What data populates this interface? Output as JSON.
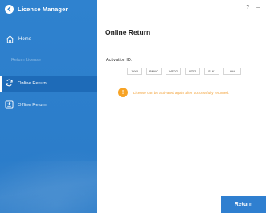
{
  "app": {
    "title": "License Manager",
    "logo_icon": "back-arrow-circle-icon"
  },
  "window_controls": {
    "help": "?",
    "minimize": "–"
  },
  "sidebar": {
    "home_label": "Home",
    "section_label": "Return License",
    "items": [
      {
        "label": "Online Return",
        "icon": "online-return-icon",
        "active": true
      },
      {
        "label": "Offline Return",
        "icon": "offline-return-icon",
        "active": false
      }
    ]
  },
  "main": {
    "title": "Online Return",
    "activation_label": "Activation ID:",
    "activation_keys": [
      "JHY6",
      "BNNC",
      "WFTG",
      "UZ02",
      "SL6J",
      "****"
    ],
    "notice_icon": "!",
    "notice_text": "License can be activated again after successfully returned.",
    "return_button": "Return"
  },
  "colors": {
    "sidebar_bg": "#2f82cf",
    "sidebar_active": "#1e6bb8",
    "accent": "#2f7fd0",
    "warning": "#f7a325"
  }
}
